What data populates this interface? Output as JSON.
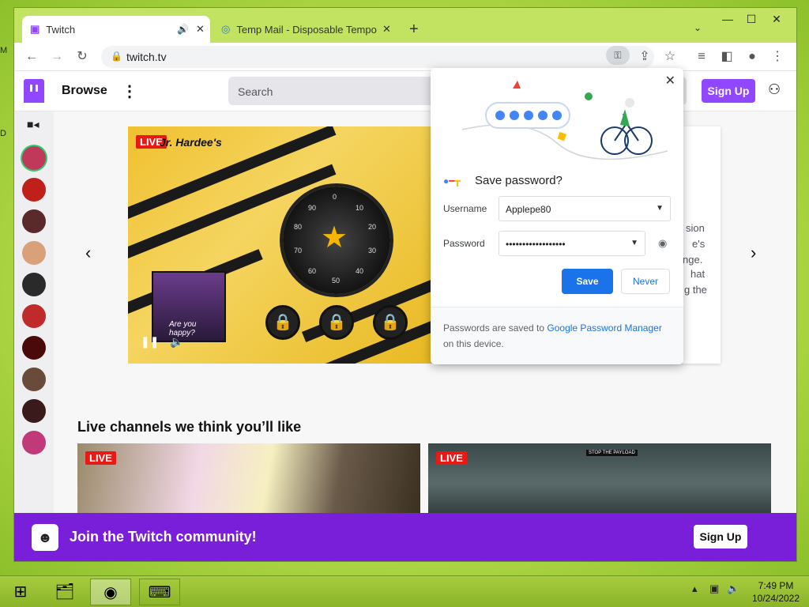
{
  "tabs": [
    {
      "label": "Twitch",
      "active": true
    },
    {
      "label": "Temp Mail - Disposable Tempora"
    }
  ],
  "window_controls": {
    "minimize": "—",
    "maximize": "☐",
    "close": "✕"
  },
  "address": {
    "url": "twitch.tv"
  },
  "twitch": {
    "browse": "Browse",
    "search_placeholder": "Search",
    "signup": "Sign Up",
    "live": "LIVE",
    "featured_brand": "Jr. Hardee's",
    "cam_text": "Are you happy?",
    "dial_numbers": [
      "0",
      "10",
      "20",
      "30",
      "40",
      "50",
      "60",
      "70",
      "80",
      "90"
    ],
    "card_lines": [
      "sion",
      "e's",
      "nge.",
      "hat",
      "g the"
    ],
    "section_title": "Live channels we think you’ll like",
    "banner_text": "Join the Twitch community!",
    "banner_signup": "Sign Up",
    "thumb2_top": "STOP THE PAYLOAD"
  },
  "popup": {
    "title": "Save password?",
    "username_label": "Username",
    "username_value": "Applepe80",
    "password_label": "Password",
    "password_value": "••••••••••••••••••",
    "save": "Save",
    "never": "Never",
    "footer_prefix": "Passwords are saved to ",
    "footer_link": "Google Password Manager",
    "footer_suffix": " on this device."
  },
  "clock": {
    "time": "7:49 PM",
    "date": "10/24/2022"
  },
  "desktop_labels": [
    "M",
    "D"
  ],
  "colors": {
    "twitch_purple": "#9146ff",
    "chrome_blue": "#1a73e8",
    "live_red": "#e91916",
    "banner": "#7a1fd9"
  }
}
